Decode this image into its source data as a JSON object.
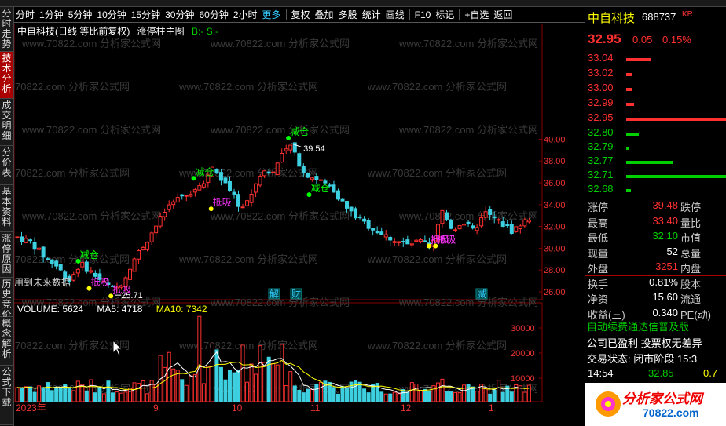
{
  "toolbar": {
    "items": [
      "分时",
      "1分钟",
      "5分钟",
      "10分钟",
      "15分钟",
      "30分钟",
      "60分钟",
      "2小时",
      "更多",
      "复权",
      "叠加",
      "多股",
      "统计",
      "画线",
      "F10",
      "标记",
      "+自选",
      "返回"
    ]
  },
  "sidetabs": [
    "分时走势",
    "技术分析",
    "成交明细",
    "分价表",
    "基本资料",
    "涨停原因",
    "历史竞价",
    "概念解析",
    "公式下载"
  ],
  "chart": {
    "title": "中自科技(日线 等比前复权)",
    "main_name": "涨停柱主图",
    "bs": "B:- S:-",
    "future": "用到未来数据",
    "high_label": "39.54",
    "low_label": "25.71",
    "markers": [
      "减仓",
      "减仓",
      "减仓",
      "减仓",
      "抵吸",
      "抵吸",
      "抵吸",
      "抵吸",
      "抵吸"
    ],
    "events": [
      "解",
      "财",
      "减"
    ],
    "y_ticks": [
      "40.00",
      "38.00",
      "36.00",
      "34.00",
      "32.00",
      "30.00",
      "28.00",
      "26.00"
    ],
    "vol_ticks": [
      "30000",
      "20000",
      "10000"
    ],
    "x_labels": [
      "2023年",
      "9",
      "10",
      "11",
      "12",
      "1"
    ],
    "volume": {
      "label": "VOLUME: 5624",
      "ma5": "MA5: 4718",
      "ma10": "MA10: 7342"
    },
    "watermark": "www.70822.com 分析家公式网"
  },
  "quote": {
    "name": "中自科技",
    "code": "688737",
    "tag": "KR",
    "price": "32.95",
    "chg": "0.05",
    "pct": "0.15%",
    "asks": [
      "33.04",
      "33.02",
      "33.00",
      "32.99",
      "32.95"
    ],
    "bids": [
      "32.80",
      "32.79",
      "32.77",
      "32.71",
      "32.68"
    ],
    "stats": [
      [
        "涨停",
        "39.48",
        "跌停"
      ],
      [
        "最高",
        "33.40",
        "量比"
      ],
      [
        "最低",
        "32.10",
        "市值"
      ],
      [
        "现量",
        "52",
        "总量"
      ],
      [
        "外盘",
        "3251",
        "内盘"
      ],
      [
        "换手",
        "0.81%",
        "股本"
      ],
      [
        "净资",
        "15.60",
        "流通"
      ],
      [
        "收益(三)",
        "0.340",
        "PE(动)"
      ]
    ],
    "ad1": "自动续费通达信普及版",
    "ad2": "公司已盈利 投票权无差异",
    "ad3": "交易状态: 闭市阶段 15:3",
    "tick_time": "14:54",
    "tick_price": "32.85",
    "tick_vol": "0.7"
  },
  "logo": {
    "text": "分析家公式网",
    "url": "70822.com"
  }
}
